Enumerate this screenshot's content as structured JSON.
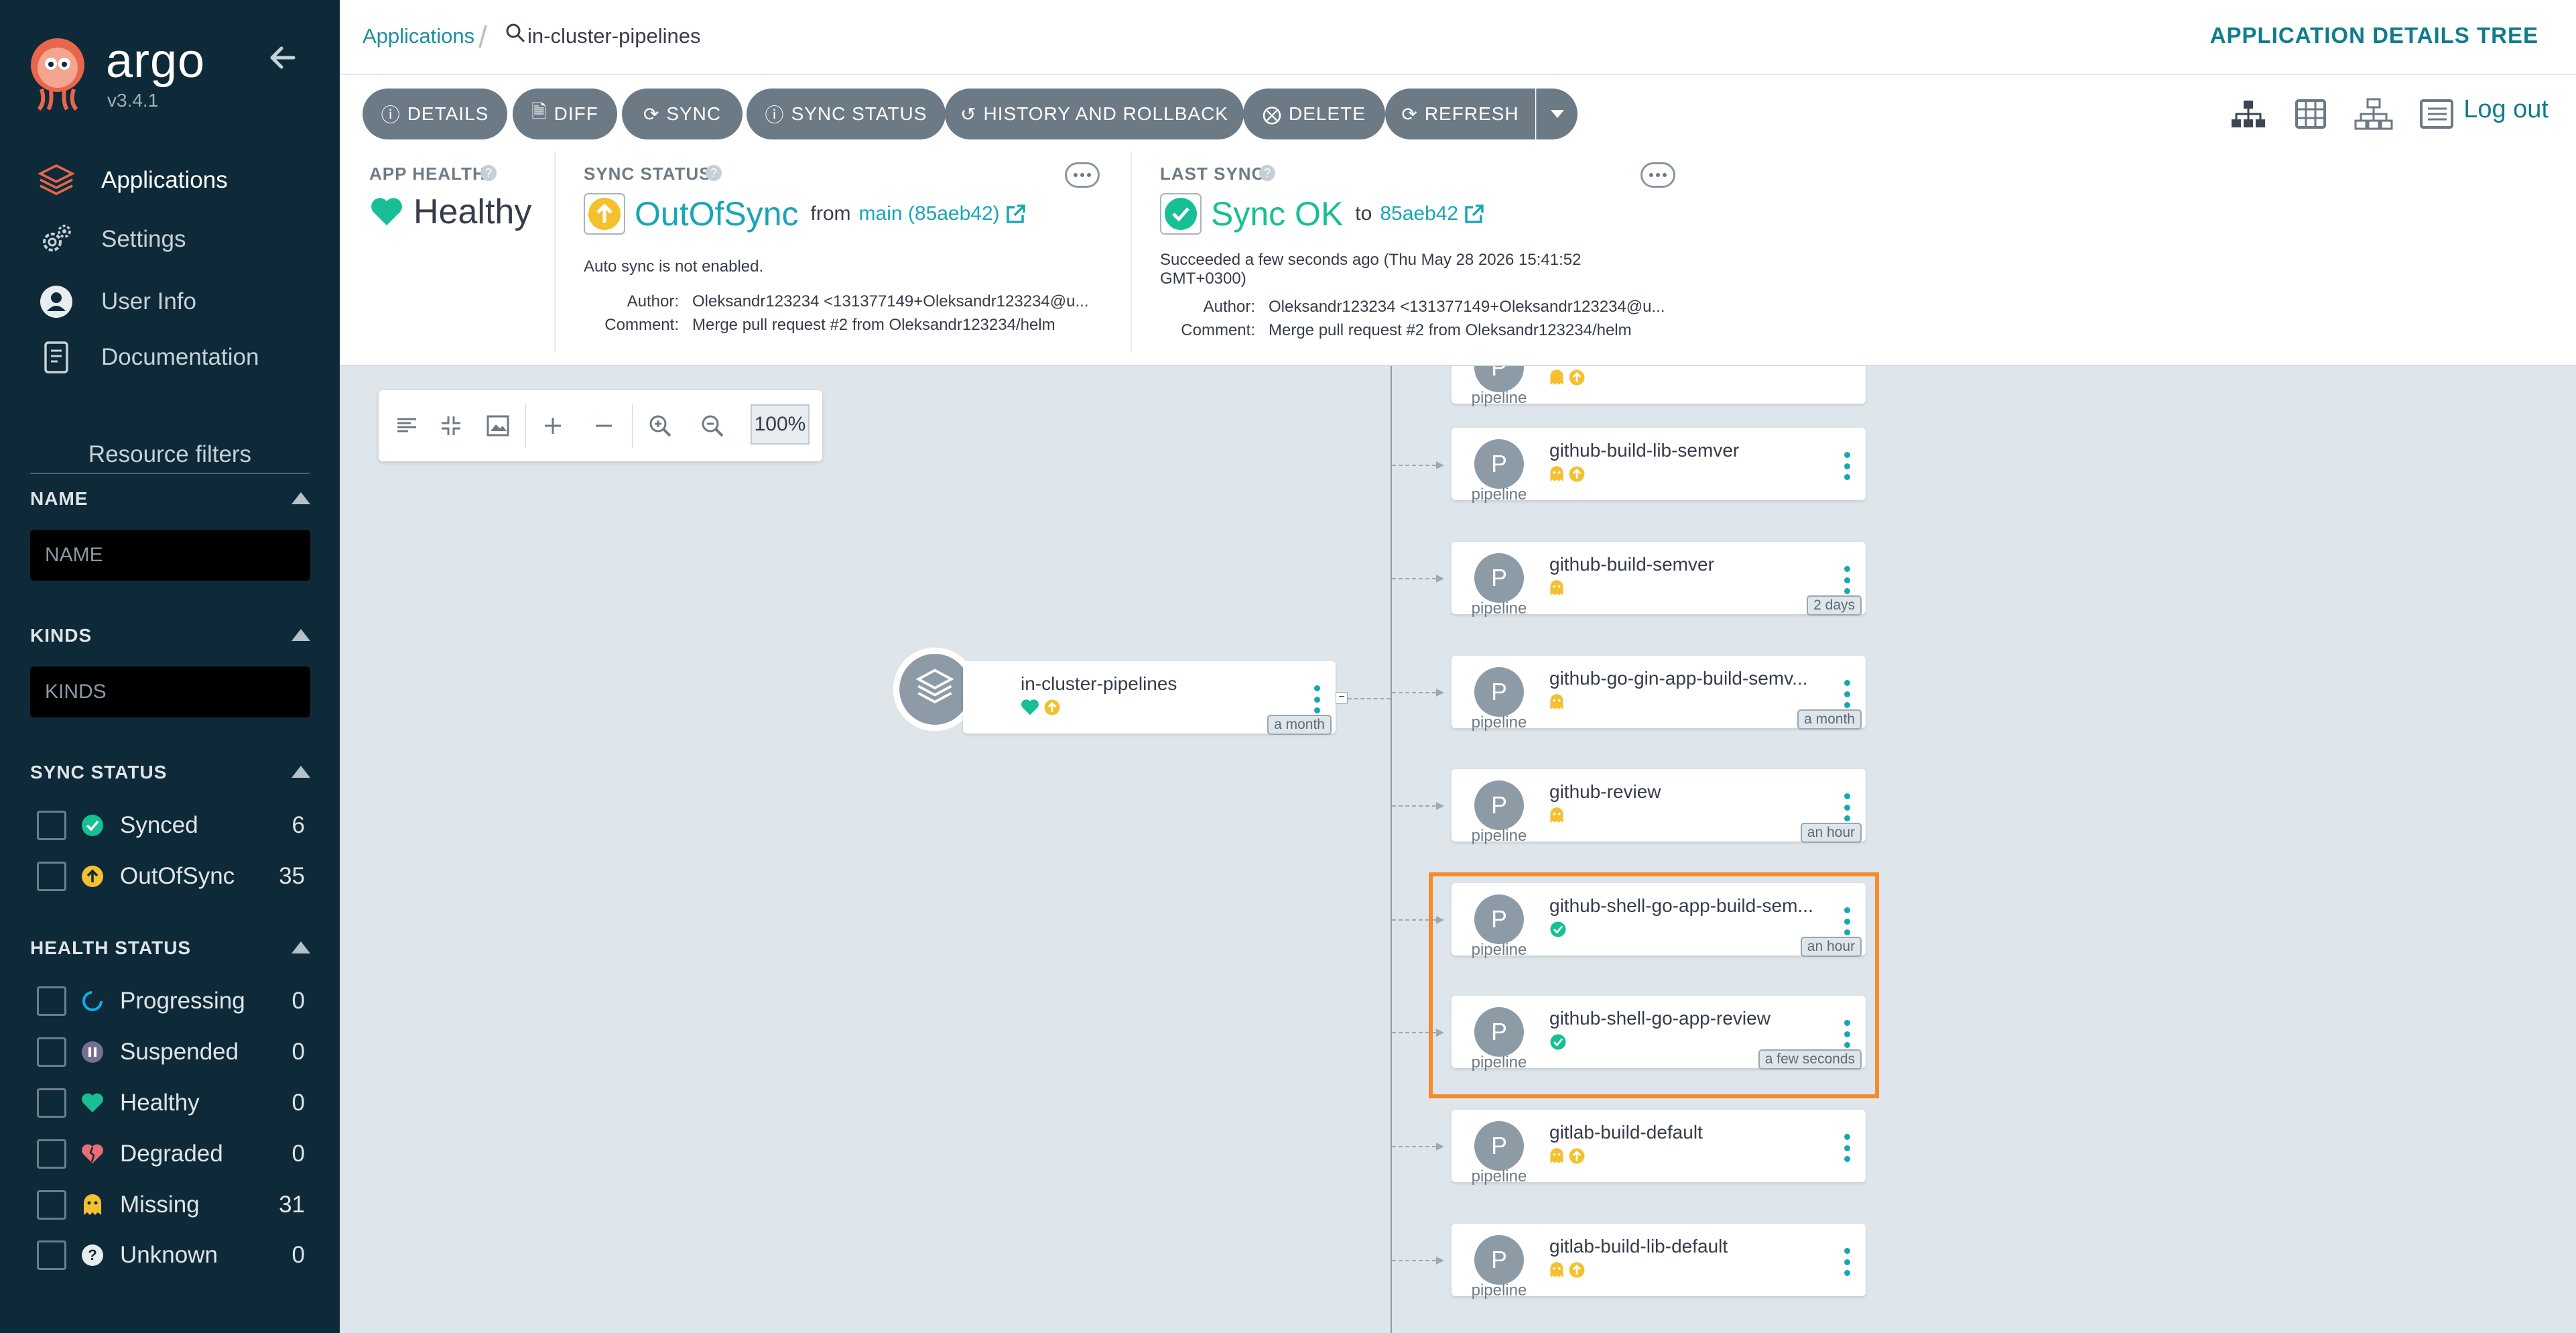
{
  "sidebar": {
    "brand": "argo",
    "version": "v3.4.1",
    "nav": [
      {
        "label": "Applications",
        "icon": "layers-icon"
      },
      {
        "label": "Settings",
        "icon": "gears-icon"
      },
      {
        "label": "User Info",
        "icon": "user-icon"
      },
      {
        "label": "Documentation",
        "icon": "book-icon"
      }
    ],
    "resource_filters_title": "Resource filters",
    "name_section": {
      "label": "NAME",
      "placeholder": "NAME"
    },
    "kinds_section": {
      "label": "KINDS",
      "placeholder": "KINDS"
    },
    "sync_status": {
      "label": "SYNC STATUS",
      "items": [
        {
          "label": "Synced",
          "count": "6"
        },
        {
          "label": "OutOfSync",
          "count": "35"
        }
      ]
    },
    "health_status": {
      "label": "HEALTH STATUS",
      "items": [
        {
          "label": "Progressing",
          "count": "0"
        },
        {
          "label": "Suspended",
          "count": "0"
        },
        {
          "label": "Healthy",
          "count": "0"
        },
        {
          "label": "Degraded",
          "count": "0"
        },
        {
          "label": "Missing",
          "count": "31"
        },
        {
          "label": "Unknown",
          "count": "0"
        }
      ]
    }
  },
  "topbar": {
    "breadcrumb_link": "Applications",
    "current": "in-cluster-pipelines",
    "title": "APPLICATION DETAILS TREE"
  },
  "toolbar": {
    "buttons": [
      "DETAILS",
      "DIFF",
      "SYNC",
      "SYNC STATUS",
      "HISTORY AND ROLLBACK",
      "DELETE",
      "REFRESH"
    ],
    "logout": "Log out"
  },
  "status": {
    "app_health": {
      "label": "APP HEALTH",
      "value": "Healthy"
    },
    "sync_status": {
      "label": "SYNC STATUS",
      "value": "OutOfSync",
      "from_text": "from",
      "revision": "main (85aeb42)",
      "note": "Auto sync is not enabled.",
      "author_key": "Author:",
      "author": "Oleksandr123234 <131377149+Oleksandr123234@u...",
      "comment_key": "Comment:",
      "comment": "Merge pull request #2 from Oleksandr123234/helm"
    },
    "last_sync": {
      "label": "LAST SYNC",
      "value": "Sync OK",
      "to_text": "to",
      "revision": "85aeb42",
      "note_line1": "Succeeded a few seconds ago (Thu May 28 2026 15:41:52",
      "note_line2": "GMT+0300)",
      "author_key": "Author:",
      "author": "Oleksandr123234 <131377149+Oleksandr123234@u...",
      "comment_key": "Comment:",
      "comment": "Merge pull request #2 from Oleksandr123234/helm"
    }
  },
  "canvas": {
    "zoom": "100%",
    "root": {
      "name": "in-cluster-pipelines",
      "age": "a month"
    },
    "nodes": [
      {
        "name": "github-build-lib-semver",
        "kind": "pipeline",
        "status": "missing-outofsync",
        "age": ""
      },
      {
        "name": "github-build-semver",
        "kind": "pipeline",
        "status": "missing",
        "age": "2 days"
      },
      {
        "name": "github-go-gin-app-build-semv...",
        "kind": "pipeline",
        "status": "missing",
        "age": "a month"
      },
      {
        "name": "github-review",
        "kind": "pipeline",
        "status": "missing",
        "age": "an hour"
      },
      {
        "name": "github-shell-go-app-build-sem...",
        "kind": "pipeline",
        "status": "synced",
        "age": "an hour"
      },
      {
        "name": "github-shell-go-app-review",
        "kind": "pipeline",
        "status": "synced",
        "age": "a few seconds"
      },
      {
        "name": "gitlab-build-default",
        "kind": "pipeline",
        "status": "missing-outofsync",
        "age": ""
      },
      {
        "name": "gitlab-build-lib-default",
        "kind": "pipeline",
        "status": "missing-outofsync",
        "age": ""
      }
    ],
    "partial_top_node_kind": "pipeline"
  },
  "colors": {
    "sidebar_bg": "#0e2a38",
    "accent_teal": "#18a6b6",
    "healthy_green": "#18be94",
    "outofsync_yellow": "#f4c030",
    "highlight_orange": "#f58b2a"
  }
}
